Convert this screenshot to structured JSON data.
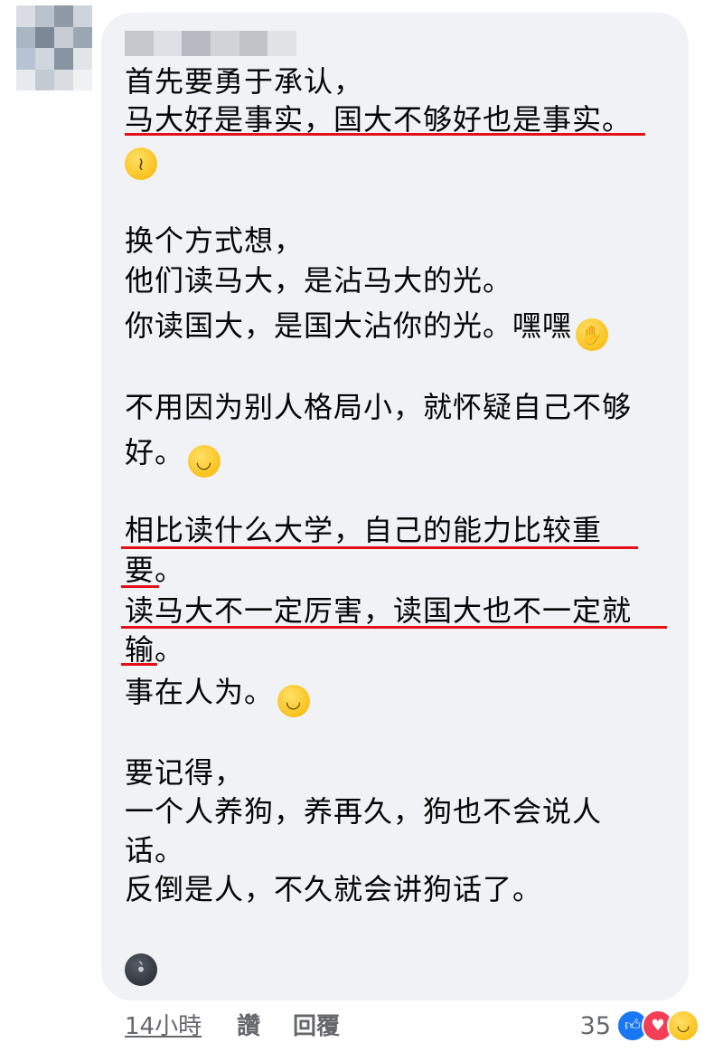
{
  "comment": {
    "lines": [
      "首先要勇于承认，",
      "马大好是事实，国大不够好也是事实。",
      "换个方式想，",
      "他们读马大，是沾马大的光。",
      "你读国大，是国大沾你的光。嘿嘿",
      "不用因为别人格局小，就怀疑自己不够",
      "好。",
      "相比读什么大学，自己的能力比较重",
      "要。",
      "读马大不一定厉害，读国大也不一定就",
      "输。",
      "事在人为。",
      "要记得，",
      "一个人养狗，养再久，狗也不会说人",
      "话。",
      "反倒是人，不久就会讲狗话了。"
    ],
    "emojis": {
      "woozy": "woozy-face-icon",
      "hand_over_mouth": "face-hand-over-mouth-icon",
      "grinning": "grinning-face-icon",
      "relieved": "relieved-face-icon",
      "new_moon": "new-moon-face-icon"
    }
  },
  "footer": {
    "time": "14小時",
    "like": "讚",
    "reply": "回覆"
  },
  "reactions": {
    "count": "35",
    "icons": [
      "like-reaction-icon",
      "love-reaction-icon",
      "haha-reaction-icon"
    ]
  },
  "colors": {
    "bubble": "#f0f2f5",
    "underline": "#e3101a",
    "text": "#050505",
    "meta": "#65676b",
    "like": "#1877f2",
    "love": "#f33e58"
  }
}
